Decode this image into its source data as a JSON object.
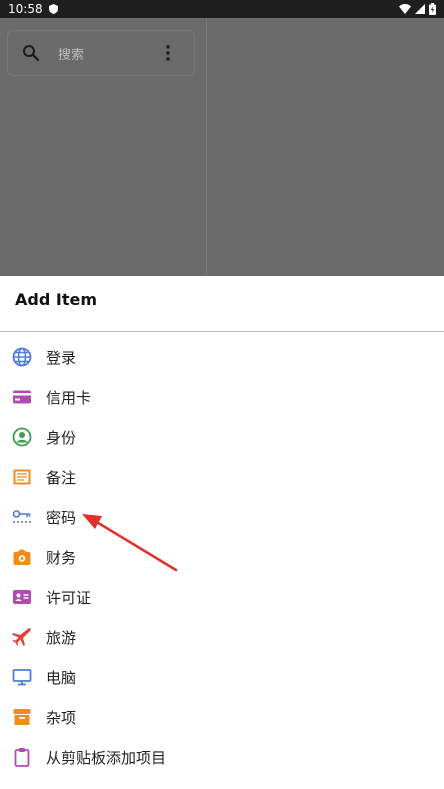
{
  "status_bar": {
    "time": "10:58"
  },
  "search": {
    "placeholder_label": "搜索"
  },
  "sheet": {
    "title": "Add Item",
    "items": [
      {
        "label": "登录",
        "icon": "globe-icon",
        "color": "#4f7bd6"
      },
      {
        "label": "信用卡",
        "icon": "credit-card-icon",
        "color": "#b04cae"
      },
      {
        "label": "身份",
        "icon": "identity-icon",
        "color": "#3e9e4a"
      },
      {
        "label": "备注",
        "icon": "note-icon",
        "color": "#f08c1e"
      },
      {
        "label": "密码",
        "icon": "key-icon",
        "color": "#4f7bd6"
      },
      {
        "label": "财务",
        "icon": "wallet-icon",
        "color": "#f08c1e"
      },
      {
        "label": "许可证",
        "icon": "license-icon",
        "color": "#b04cae"
      },
      {
        "label": "旅游",
        "icon": "airplane-icon",
        "color": "#e2413a"
      },
      {
        "label": "电脑",
        "icon": "computer-icon",
        "color": "#4f7bd6"
      },
      {
        "label": "杂项",
        "icon": "archive-box-icon",
        "color": "#f08c1e"
      },
      {
        "label": "从剪贴板添加项目",
        "icon": "clipboard-icon",
        "color": "#b04cae"
      }
    ]
  }
}
